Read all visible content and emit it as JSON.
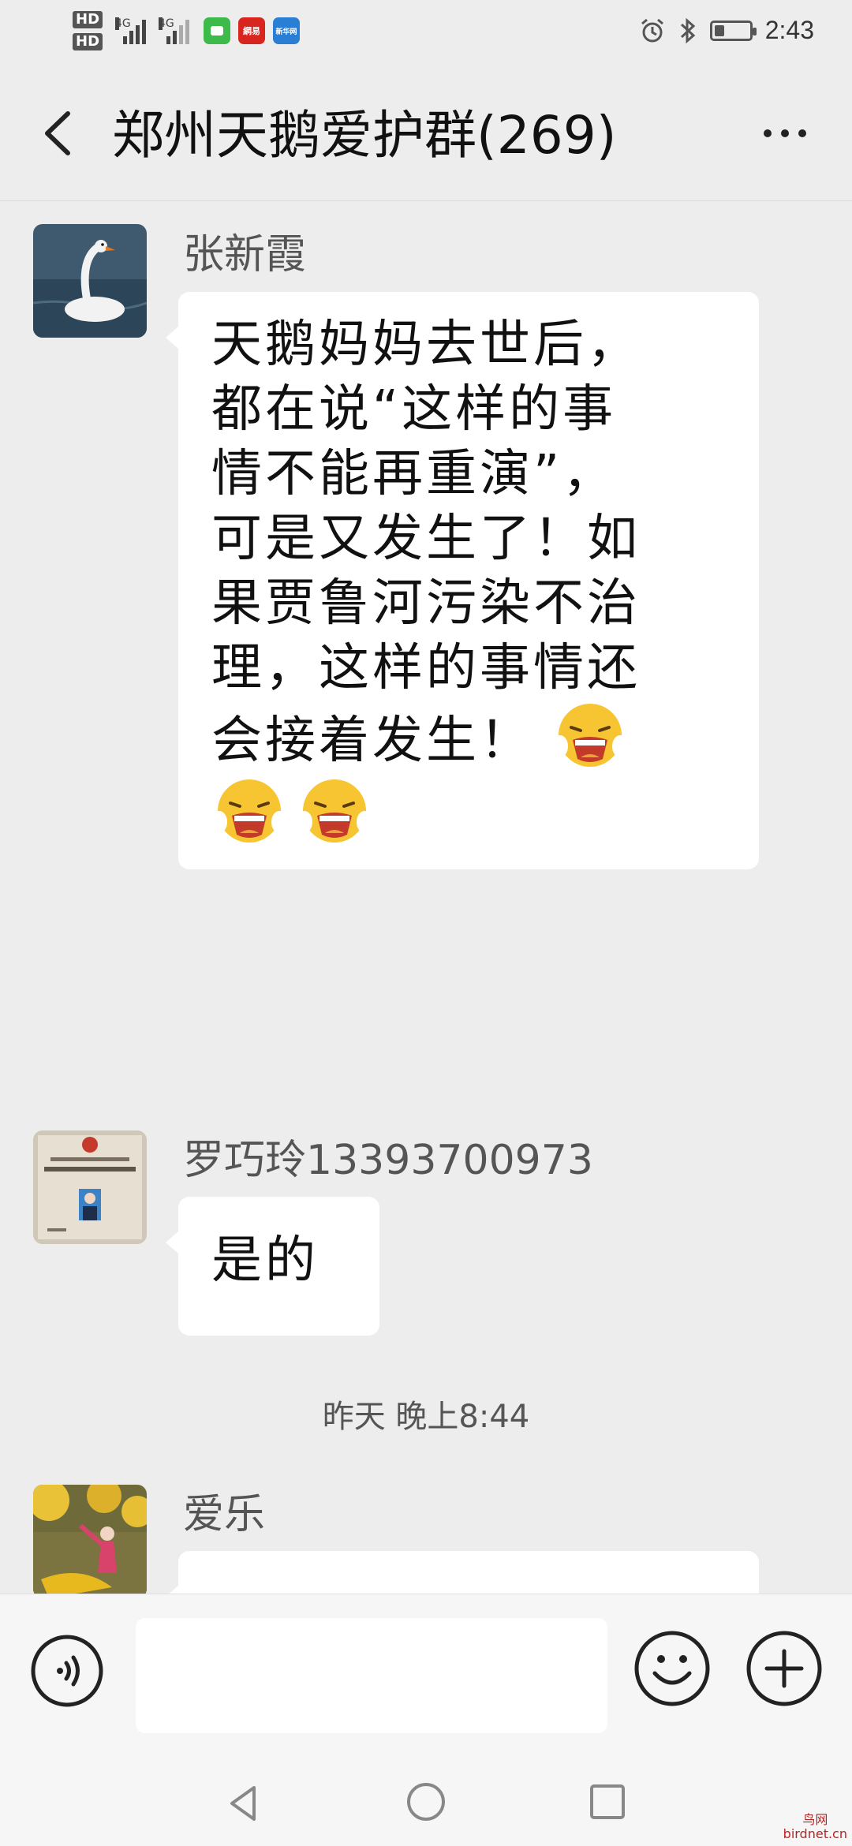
{
  "status_bar": {
    "hd1": "HD",
    "hd2": "HD",
    "net1": "4G",
    "net2": "4G",
    "apps": [
      {
        "name": "wechat-notification-icon",
        "color": "#3dbb4a",
        "label": ""
      },
      {
        "name": "netease-news-icon",
        "color": "#d8251d",
        "label": "網易"
      },
      {
        "name": "xinhua-news-icon",
        "color": "#2a7fd4",
        "label": "新华网"
      }
    ],
    "battery_level_percent": 30,
    "time": "2:43"
  },
  "header": {
    "title": "郑州天鹅爱护群(269)"
  },
  "messages": [
    {
      "sender": "张新霞",
      "avatar": "swan-avatar",
      "lines": [
        "天鹅妈妈去世后，",
        "都在说“这样的事",
        "情不能再重演”，",
        "可是又发生了！如",
        "果贾鲁河污染不治",
        "理，这样的事情还",
        "会接着发生！"
      ]
    },
    {
      "sender": "罗巧玲13393700973",
      "avatar": "certificate-avatar",
      "text": "是的"
    },
    {
      "timestamp": "昨天 晚上8:44"
    },
    {
      "sender": "爱乐",
      "avatar": "dancer-avatar"
    }
  ],
  "input_bar": {
    "placeholder": ""
  },
  "watermark": {
    "text1": "鸟网",
    "text2": "birdnet.cn"
  }
}
